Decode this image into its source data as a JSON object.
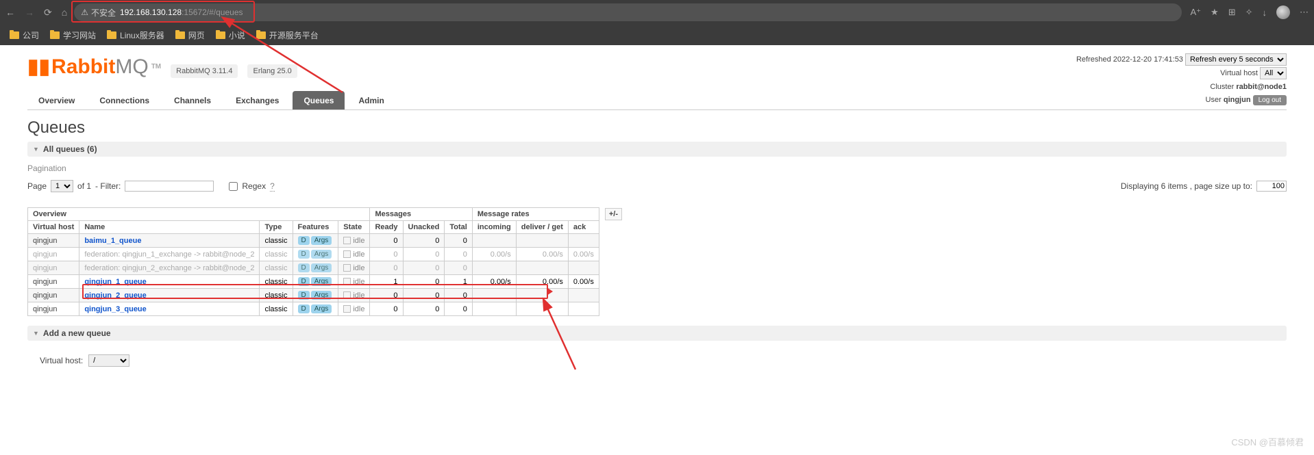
{
  "browser": {
    "insecure": "不安全",
    "url_host": "192.168.130.128",
    "url_rest": ":15672/#/queues"
  },
  "bookmarks": [
    "公司",
    "学习网站",
    "Linux服务器",
    "网页",
    "小说",
    "开源服务平台"
  ],
  "header": {
    "brand_rabbit": "Rabbit",
    "brand_mq": "MQ",
    "tm": "TM",
    "version": "RabbitMQ 3.11.4",
    "erlang": "Erlang 25.0",
    "refreshed_label": "Refreshed",
    "refreshed_time": "2022-12-20 17:41:53",
    "refresh_opt": "Refresh every 5 seconds",
    "vhost_label": "Virtual host",
    "vhost_value": "All",
    "cluster_label": "Cluster",
    "cluster_value": "rabbit@node1",
    "user_label": "User",
    "user_value": "qingjun",
    "logout": "Log out"
  },
  "tabs": [
    "Overview",
    "Connections",
    "Channels",
    "Exchanges",
    "Queues",
    "Admin"
  ],
  "active_tab": "Queues",
  "page_title": "Queues",
  "all_queues": "All queues (6)",
  "pagination_label": "Pagination",
  "pag": {
    "page_word": "Page",
    "page_val": "1",
    "of_word": "of 1",
    "filter_dash": "- Filter:",
    "regex": "Regex",
    "help": "?",
    "displaying": "Displaying 6 items , page size up to:",
    "size": "100"
  },
  "table": {
    "groups": {
      "overview": "Overview",
      "messages": "Messages",
      "rates": "Message rates",
      "pm": "+/-"
    },
    "cols": {
      "vhost": "Virtual host",
      "name": "Name",
      "type": "Type",
      "features": "Features",
      "state": "State",
      "ready": "Ready",
      "unacked": "Unacked",
      "total": "Total",
      "incoming": "incoming",
      "deliver": "deliver / get",
      "ack": "ack"
    },
    "feat_d": "D",
    "feat_args": "Args",
    "idle": "idle",
    "rows": [
      {
        "vhost": "qingjun",
        "name": "baimu_1_queue",
        "type": "classic",
        "ready": "0",
        "unacked": "0",
        "total": "0",
        "incoming": "",
        "deliver": "",
        "ack": "",
        "dim": false
      },
      {
        "vhost": "qingjun",
        "name": "federation: qingjun_1_exchange -> rabbit@node_2",
        "type": "classic",
        "ready": "0",
        "unacked": "0",
        "total": "0",
        "incoming": "0.00/s",
        "deliver": "0.00/s",
        "ack": "0.00/s",
        "dim": true
      },
      {
        "vhost": "qingjun",
        "name": "federation: qingjun_2_exchange -> rabbit@node_2",
        "type": "classic",
        "ready": "0",
        "unacked": "0",
        "total": "0",
        "incoming": "",
        "deliver": "",
        "ack": "",
        "dim": true
      },
      {
        "vhost": "qingjun",
        "name": "qingjun_1_queue",
        "type": "classic",
        "ready": "1",
        "unacked": "0",
        "total": "1",
        "incoming": "0.00/s",
        "deliver": "0.00/s",
        "ack": "0.00/s",
        "dim": false
      },
      {
        "vhost": "qingjun",
        "name": "qingjun_2_queue",
        "type": "classic",
        "ready": "0",
        "unacked": "0",
        "total": "0",
        "incoming": "",
        "deliver": "",
        "ack": "",
        "dim": false
      },
      {
        "vhost": "qingjun",
        "name": "qingjun_3_queue",
        "type": "classic",
        "ready": "0",
        "unacked": "0",
        "total": "0",
        "incoming": "",
        "deliver": "",
        "ack": "",
        "dim": false
      }
    ]
  },
  "add_queue": "Add a new queue",
  "addq_vhost_label": "Virtual host:",
  "addq_vhost_value": "/",
  "watermark": "CSDN @百慕倾君"
}
